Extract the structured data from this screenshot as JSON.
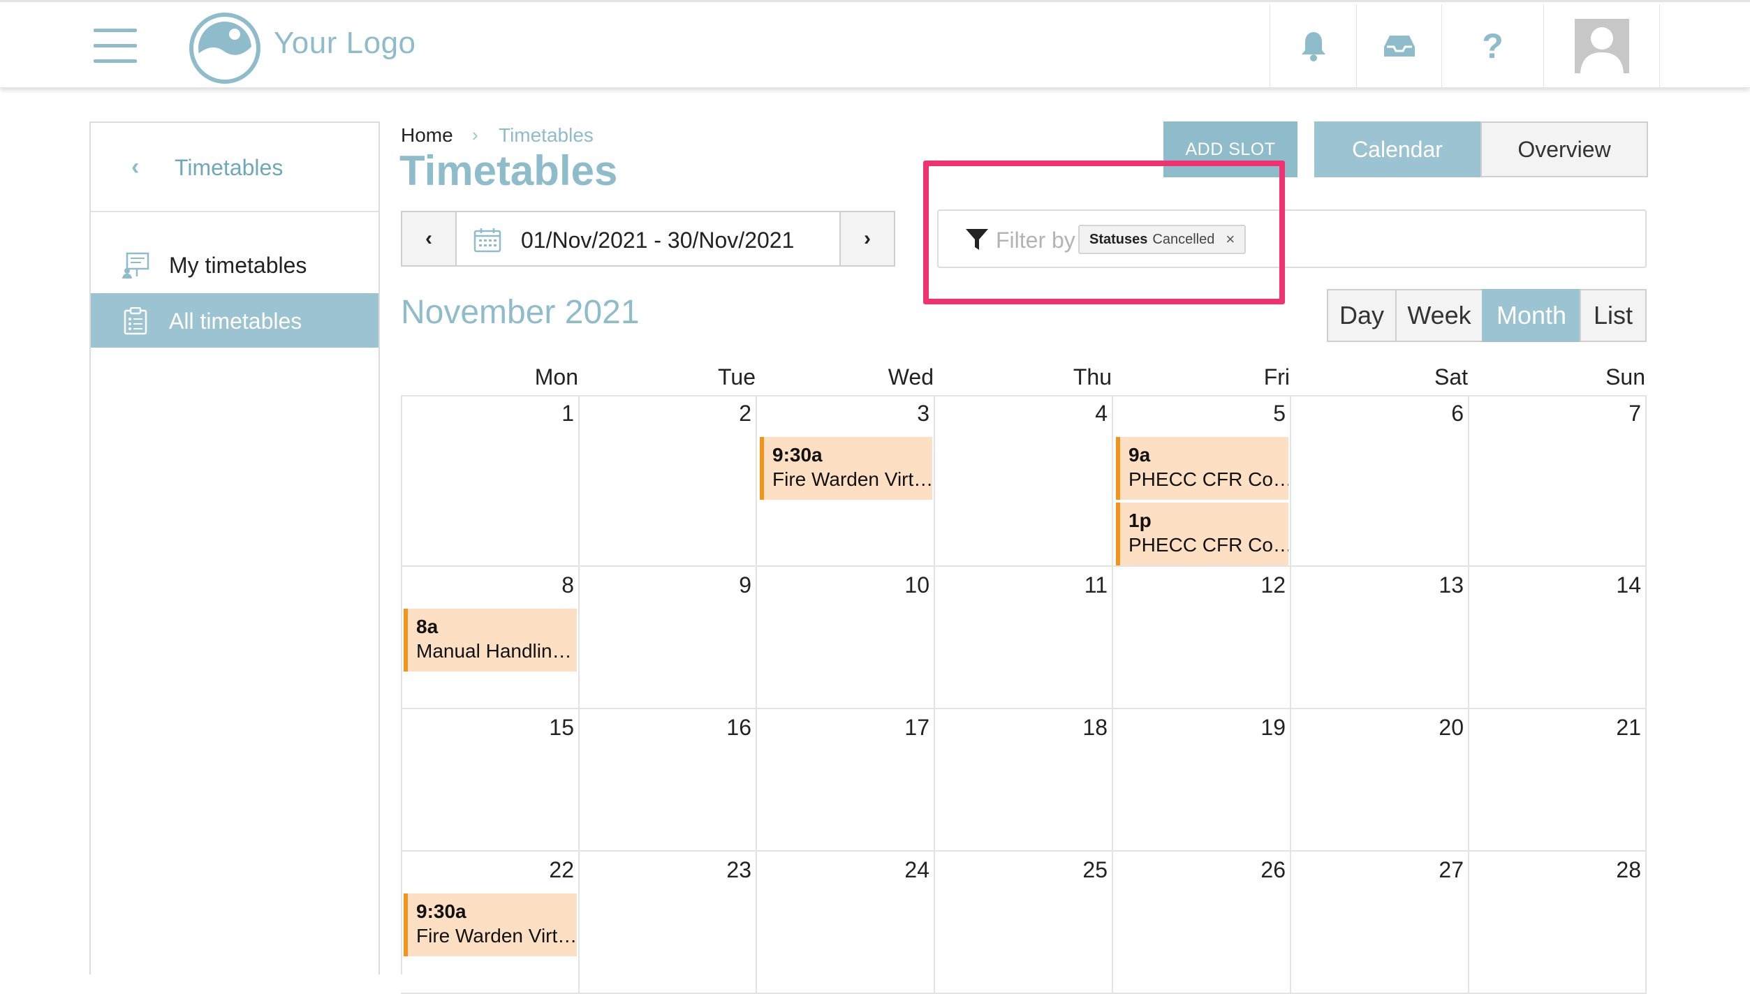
{
  "header": {
    "logo_text": "Your Logo",
    "icons": [
      "hamburger-menu-icon",
      "bell-icon",
      "inbox-icon",
      "help-icon",
      "user-avatar-icon"
    ],
    "help_glyph": "?"
  },
  "sidebar": {
    "back_label": "Timetables",
    "back_glyph": "‹",
    "items": [
      {
        "label": "My timetables",
        "icon": "presentation-icon",
        "active": false
      },
      {
        "label": "All timetables",
        "icon": "clipboard-list-icon",
        "active": true
      }
    ]
  },
  "breadcrumb": {
    "home": "Home",
    "separator": "›",
    "current": "Timetables"
  },
  "page_title": "Timetables",
  "actions": {
    "add_slot": "ADD SLOT",
    "calendar": "Calendar",
    "overview": "Overview"
  },
  "date_range": {
    "prev": "‹",
    "value": "01/Nov/2021 - 30/Nov/2021",
    "next": "›"
  },
  "filter": {
    "placeholder": "Filter by",
    "chip_key": "Statuses",
    "chip_value": "Cancelled",
    "chip_remove": "×"
  },
  "calendar": {
    "month_title": "November 2021",
    "views": {
      "day": "Day",
      "week": "Week",
      "month": "Month",
      "list": "List",
      "active": "Month"
    },
    "weekdays": [
      "Mon",
      "Tue",
      "Wed",
      "Thu",
      "Fri",
      "Sat",
      "Sun"
    ],
    "weeks": [
      [
        "1",
        "2",
        "3",
        "4",
        "5",
        "6",
        "7"
      ],
      [
        "8",
        "9",
        "10",
        "11",
        "12",
        "13",
        "14"
      ],
      [
        "15",
        "16",
        "17",
        "18",
        "19",
        "20",
        "21"
      ],
      [
        "22",
        "23",
        "24",
        "25",
        "26",
        "27",
        "28"
      ]
    ],
    "events": [
      {
        "day": "3",
        "time": "9:30a",
        "title": "Fire Warden Virt…"
      },
      {
        "day": "5",
        "time": "9a",
        "title": "PHECC CFR Co…"
      },
      {
        "day": "5",
        "time": "1p",
        "title": "PHECC CFR Co…"
      },
      {
        "day": "8",
        "time": "8a",
        "title": "Manual Handlin…"
      },
      {
        "day": "22",
        "time": "9:30a",
        "title": "Fire Warden Virt…"
      }
    ]
  },
  "colors": {
    "accent": "#8fbccb",
    "active_bg": "#9cc3d1",
    "event_bg": "#fde0c3",
    "event_border": "#f0941a",
    "highlight": "#f03370"
  }
}
